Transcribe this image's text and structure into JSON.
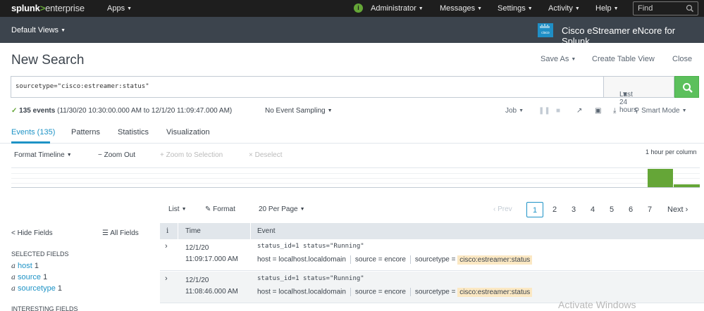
{
  "topbar": {
    "logo_bold": "splunk",
    "logo_chevron": ">",
    "logo_product": "enterprise",
    "apps": "Apps",
    "admin_badge": "i",
    "administrator": "Administrator",
    "messages": "Messages",
    "settings": "Settings",
    "activity": "Activity",
    "help": "Help",
    "find_placeholder": "Find"
  },
  "appbar": {
    "default_views": "Default Views",
    "app_logo_text": "cisco",
    "app_name": "Cisco eStreamer eNcore for Splunk"
  },
  "header": {
    "title": "New Search",
    "save_as": "Save As",
    "create_table_view": "Create Table View",
    "close": "Close"
  },
  "search": {
    "query": "sourcetype=\"cisco:estreamer:status\"",
    "time_range": "Last 24 hours"
  },
  "status": {
    "check": "✓",
    "events_count": "135 events",
    "range": "(11/30/20 10:30:00.000 AM to 12/1/20 11:09:47.000 AM)",
    "sampling": "No Event Sampling",
    "job": "Job",
    "mode": "Smart Mode"
  },
  "tabs": [
    "Events (135)",
    "Patterns",
    "Statistics",
    "Visualization"
  ],
  "timeline": {
    "format": "Format Timeline",
    "zoom_out": "− Zoom Out",
    "zoom_selection": "+ Zoom to Selection",
    "deselect": "× Deselect",
    "per_column": "1 hour per column",
    "bars": [
      0.92,
      0.15
    ]
  },
  "results": {
    "list": "List",
    "format": "Format",
    "per_page": "20 Per Page",
    "prev": "‹ Prev",
    "pages": [
      "1",
      "2",
      "3",
      "4",
      "5",
      "6",
      "7"
    ],
    "next": "Next ›"
  },
  "sidebar": {
    "hide_fields": "< Hide Fields",
    "all_fields": "All Fields",
    "selected_heading": "SELECTED FIELDS",
    "interesting_heading": "INTERESTING FIELDS",
    "selected": [
      {
        "type": "a",
        "name": "host",
        "count": "1"
      },
      {
        "type": "a",
        "name": "source",
        "count": "1"
      },
      {
        "type": "a",
        "name": "sourcetype",
        "count": "1"
      }
    ]
  },
  "table": {
    "col_info": "i",
    "col_time": "Time",
    "col_event": "Event",
    "rows": [
      {
        "date": "12/1/20",
        "time": "11:09:17.000 AM",
        "raw": "status_id=1 status=\"Running\"",
        "host": "host = localhost.localdomain",
        "source": "source = encore",
        "sourcetype_label": "sourcetype =",
        "sourcetype": "cisco:estreamer:status"
      },
      {
        "date": "12/1/20",
        "time": "11:08:46.000 AM",
        "raw": "status_id=1 status=\"Running\"",
        "host": "host = localhost.localdomain",
        "source": "source = encore",
        "sourcetype_label": "sourcetype =",
        "sourcetype": "cisco:estreamer:status"
      }
    ]
  },
  "watermark": "Activate Windows",
  "colors": {
    "accent": "#1e93c6",
    "go_button": "#5cc05c",
    "topbar": "#1e1e1e",
    "appbar": "#3c444d",
    "highlight": "#fbe8c3"
  }
}
